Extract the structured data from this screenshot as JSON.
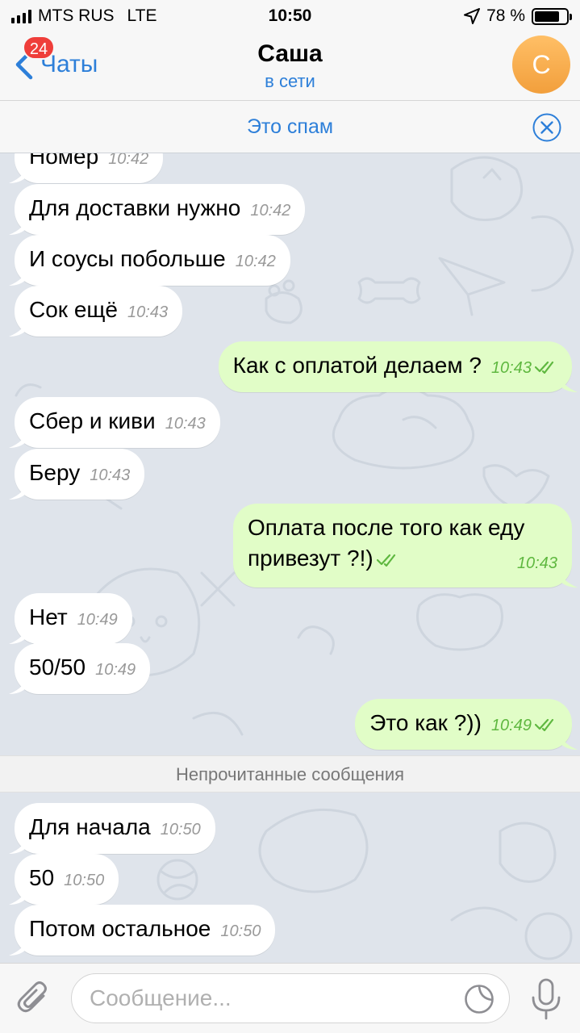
{
  "status_bar": {
    "carrier": "MTS RUS",
    "network": "LTE",
    "time": "10:50",
    "battery": "78 %",
    "battery_level": 0.78
  },
  "nav": {
    "back_label": "Чаты",
    "unread_badge": "24",
    "title": "Саша",
    "subtitle": "в сети",
    "avatar_letter": "С"
  },
  "spam_bar": {
    "label": "Это спам"
  },
  "messages": [
    {
      "dir": "in",
      "text": "Номер",
      "time": "10:42"
    },
    {
      "dir": "in",
      "text": "Для доставки нужно",
      "time": "10:42"
    },
    {
      "dir": "in",
      "text": "И соусы побольше",
      "time": "10:42"
    },
    {
      "dir": "in",
      "text": "Сок ещё",
      "time": "10:43"
    },
    {
      "dir": "out",
      "text": "Как с оплатой делаем ?",
      "time": "10:43"
    },
    {
      "dir": "in",
      "text": "Сбер и киви",
      "time": "10:43"
    },
    {
      "dir": "in",
      "text": "Беру",
      "time": "10:43"
    },
    {
      "dir": "out",
      "text": "Оплата после того как еду привезут ?!)",
      "time": "10:43"
    },
    {
      "dir": "in",
      "text": "Нет",
      "time": "10:49"
    },
    {
      "dir": "in",
      "text": "50/50",
      "time": "10:49"
    },
    {
      "dir": "out",
      "text": "Это как ?))",
      "time": "10:49"
    },
    {
      "dir": "in",
      "text": "Для начала",
      "time": "10:50"
    },
    {
      "dir": "in",
      "text": "50",
      "time": "10:50"
    },
    {
      "dir": "in",
      "text": "Потом остальное",
      "time": "10:50"
    }
  ],
  "unread_divider": "Непрочитанные сообщения",
  "input": {
    "placeholder": "Сообщение...",
    "value": ""
  },
  "colors": {
    "accent": "#2d7fd9",
    "outgoing_bubble": "#e1fdc7",
    "incoming_bubble": "#ffffff",
    "read_check": "#5fb840",
    "badge": "#ef3e3a",
    "avatar": "#f29f3c"
  },
  "icons": [
    "cellular-signal-icon",
    "location-arrow-icon",
    "battery-icon",
    "back-chevron-icon",
    "close-circle-icon",
    "double-check-icon",
    "paperclip-icon",
    "sticker-icon",
    "microphone-icon"
  ]
}
